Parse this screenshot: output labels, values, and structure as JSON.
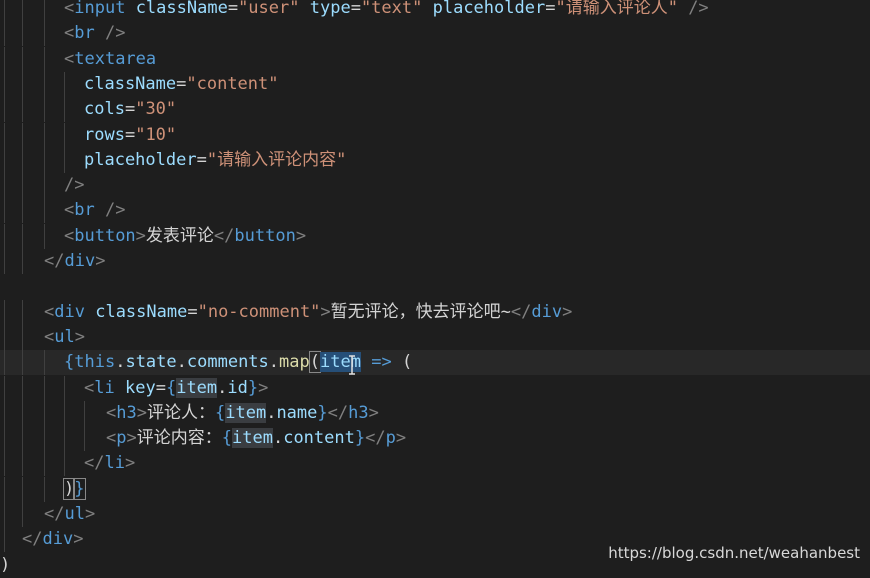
{
  "editor": {
    "lines": [
      {
        "current": false,
        "tokens": [
          {
            "t": "<",
            "c": "tag-punct"
          },
          {
            "t": "input",
            "c": "tag"
          },
          {
            "t": " "
          },
          {
            "t": "className",
            "c": "attr"
          },
          {
            "t": "=",
            "c": "eq"
          },
          {
            "t": "\"user\"",
            "c": "str"
          },
          {
            "t": " "
          },
          {
            "t": "type",
            "c": "attr"
          },
          {
            "t": "=",
            "c": "eq"
          },
          {
            "t": "\"text\"",
            "c": "str"
          },
          {
            "t": " "
          },
          {
            "t": "placeholder",
            "c": "attr"
          },
          {
            "t": "=",
            "c": "eq"
          },
          {
            "t": "\"请输入评论人\"",
            "c": "str"
          },
          {
            "t": " "
          },
          {
            "t": "/>",
            "c": "tag-punct"
          }
        ]
      },
      {
        "current": false,
        "tokens": [
          {
            "t": "<",
            "c": "tag-punct"
          },
          {
            "t": "br",
            "c": "tag"
          },
          {
            "t": " "
          },
          {
            "t": "/>",
            "c": "tag-punct"
          }
        ]
      },
      {
        "current": false,
        "tokens": [
          {
            "t": "<",
            "c": "tag-punct"
          },
          {
            "t": "textarea",
            "c": "tag"
          }
        ]
      },
      {
        "current": false,
        "tokens": [
          {
            "t": "className",
            "c": "attr"
          },
          {
            "t": "=",
            "c": "eq"
          },
          {
            "t": "\"content\"",
            "c": "str"
          }
        ]
      },
      {
        "current": false,
        "tokens": [
          {
            "t": "cols",
            "c": "attr"
          },
          {
            "t": "=",
            "c": "eq"
          },
          {
            "t": "\"30\"",
            "c": "str"
          }
        ]
      },
      {
        "current": false,
        "tokens": [
          {
            "t": "rows",
            "c": "attr"
          },
          {
            "t": "=",
            "c": "eq"
          },
          {
            "t": "\"10\"",
            "c": "str"
          }
        ]
      },
      {
        "current": false,
        "tokens": [
          {
            "t": "placeholder",
            "c": "attr"
          },
          {
            "t": "=",
            "c": "eq"
          },
          {
            "t": "\"请输入评论内容\"",
            "c": "str"
          }
        ]
      },
      {
        "current": false,
        "tokens": [
          {
            "t": "/>",
            "c": "tag-punct"
          }
        ]
      },
      {
        "current": false,
        "tokens": [
          {
            "t": "<",
            "c": "tag-punct"
          },
          {
            "t": "br",
            "c": "tag"
          },
          {
            "t": " "
          },
          {
            "t": "/>",
            "c": "tag-punct"
          }
        ]
      },
      {
        "current": false,
        "tokens": [
          {
            "t": "<",
            "c": "tag-punct"
          },
          {
            "t": "button",
            "c": "tag"
          },
          {
            "t": ">",
            "c": "tag-punct"
          },
          {
            "t": "发表评论",
            "c": "text"
          },
          {
            "t": "</",
            "c": "tag-punct"
          },
          {
            "t": "button",
            "c": "tag"
          },
          {
            "t": ">",
            "c": "tag-punct"
          }
        ]
      },
      {
        "current": false,
        "tokens": [
          {
            "t": "</",
            "c": "tag-punct"
          },
          {
            "t": "div",
            "c": "tag"
          },
          {
            "t": ">",
            "c": "tag-punct"
          }
        ]
      },
      {
        "current": false,
        "tokens": []
      },
      {
        "current": false,
        "tokens": [
          {
            "t": "<",
            "c": "tag-punct"
          },
          {
            "t": "div",
            "c": "tag"
          },
          {
            "t": " "
          },
          {
            "t": "className",
            "c": "attr"
          },
          {
            "t": "=",
            "c": "eq"
          },
          {
            "t": "\"no-comment\"",
            "c": "str"
          },
          {
            "t": ">",
            "c": "tag-punct"
          },
          {
            "t": "暂无评论，快去评论吧~",
            "c": "text"
          },
          {
            "t": "</",
            "c": "tag-punct"
          },
          {
            "t": "div",
            "c": "tag"
          },
          {
            "t": ">",
            "c": "tag-punct"
          }
        ]
      },
      {
        "current": false,
        "tokens": [
          {
            "t": "<",
            "c": "tag-punct"
          },
          {
            "t": "ul",
            "c": "tag"
          },
          {
            "t": ">",
            "c": "tag-punct"
          }
        ]
      },
      {
        "current": true,
        "tokens": [
          {
            "t": "{",
            "c": "brace"
          },
          {
            "t": "this",
            "c": "kw"
          },
          {
            "t": ".",
            "c": "text"
          },
          {
            "t": "state",
            "c": "var"
          },
          {
            "t": ".",
            "c": "text"
          },
          {
            "t": "comments",
            "c": "var"
          },
          {
            "t": ".",
            "c": "text"
          },
          {
            "t": "map",
            "c": "fn"
          },
          {
            "t": "(",
            "c": "text match"
          },
          {
            "t": "item",
            "c": "var sel"
          },
          {
            "t": " "
          },
          {
            "t": "=>",
            "c": "kw"
          },
          {
            "t": " "
          },
          {
            "t": "(",
            "c": "text"
          }
        ]
      },
      {
        "current": false,
        "tokens": [
          {
            "t": "<",
            "c": "tag-punct"
          },
          {
            "t": "li",
            "c": "tag"
          },
          {
            "t": " "
          },
          {
            "t": "key",
            "c": "attr"
          },
          {
            "t": "=",
            "c": "eq"
          },
          {
            "t": "{",
            "c": "brace"
          },
          {
            "t": "item",
            "c": "var hl"
          },
          {
            "t": ".",
            "c": "text"
          },
          {
            "t": "id",
            "c": "var"
          },
          {
            "t": "}",
            "c": "brace"
          },
          {
            "t": ">",
            "c": "tag-punct"
          }
        ]
      },
      {
        "current": false,
        "tokens": [
          {
            "t": "<",
            "c": "tag-punct"
          },
          {
            "t": "h3",
            "c": "tag"
          },
          {
            "t": ">",
            "c": "tag-punct"
          },
          {
            "t": "评论人：",
            "c": "text"
          },
          {
            "t": "{",
            "c": "brace"
          },
          {
            "t": "item",
            "c": "var hl"
          },
          {
            "t": ".",
            "c": "text"
          },
          {
            "t": "name",
            "c": "var"
          },
          {
            "t": "}",
            "c": "brace"
          },
          {
            "t": "</",
            "c": "tag-punct"
          },
          {
            "t": "h3",
            "c": "tag"
          },
          {
            "t": ">",
            "c": "tag-punct"
          }
        ]
      },
      {
        "current": false,
        "tokens": [
          {
            "t": "<",
            "c": "tag-punct"
          },
          {
            "t": "p",
            "c": "tag"
          },
          {
            "t": ">",
            "c": "tag-punct"
          },
          {
            "t": "评论内容：",
            "c": "text"
          },
          {
            "t": "{",
            "c": "brace"
          },
          {
            "t": "item",
            "c": "var hl"
          },
          {
            "t": ".",
            "c": "text"
          },
          {
            "t": "content",
            "c": "var"
          },
          {
            "t": "}",
            "c": "brace"
          },
          {
            "t": "</",
            "c": "tag-punct"
          },
          {
            "t": "p",
            "c": "tag"
          },
          {
            "t": ">",
            "c": "tag-punct"
          }
        ]
      },
      {
        "current": false,
        "tokens": [
          {
            "t": "</",
            "c": "tag-punct"
          },
          {
            "t": "li",
            "c": "tag"
          },
          {
            "t": ">",
            "c": "tag-punct"
          }
        ]
      },
      {
        "current": false,
        "tokens": [
          {
            "t": ")",
            "c": "text match"
          },
          {
            "t": "}",
            "c": "brace match"
          }
        ]
      },
      {
        "current": false,
        "tokens": [
          {
            "t": "</",
            "c": "tag-punct"
          },
          {
            "t": "ul",
            "c": "tag"
          },
          {
            "t": ">",
            "c": "tag-punct"
          }
        ]
      },
      {
        "current": false,
        "tokens": [
          {
            "t": "</",
            "c": "tag-punct"
          },
          {
            "t": "div",
            "c": "tag"
          },
          {
            "t": ">",
            "c": "tag-punct"
          }
        ]
      },
      {
        "current": false,
        "tokens": [
          {
            "t": ")",
            "c": "text"
          }
        ]
      }
    ]
  },
  "watermark": "https://blog.csdn.net/weahanbest",
  "cursor_icon": "text-cursor-icon"
}
